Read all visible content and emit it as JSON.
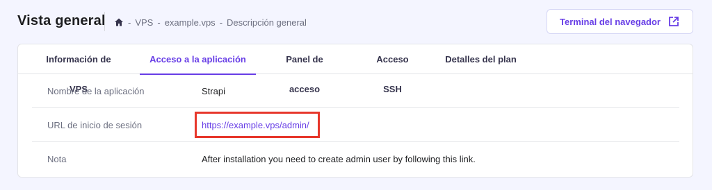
{
  "header": {
    "title": "Vista general",
    "breadcrumb": {
      "separator": "-",
      "items": [
        "VPS",
        "example.vps",
        "Descripción general"
      ]
    },
    "browser_terminal_label": "Terminal del navegador"
  },
  "tabs": [
    {
      "label": "Información de VPS",
      "active": false
    },
    {
      "label": "Acceso a la aplicación",
      "active": true
    },
    {
      "label": "Panel de acceso",
      "active": false
    },
    {
      "label": "Acceso SSH",
      "active": false
    },
    {
      "label": "Detalles del plan",
      "active": false
    }
  ],
  "details": [
    {
      "label": "Nombre de la aplicación",
      "value": "Strapi"
    },
    {
      "label": "URL de inicio de sesión",
      "value": "https://example.vps/admin/"
    },
    {
      "label": "Nota",
      "value": "After installation you need to create admin user by following this link."
    }
  ],
  "colors": {
    "accent": "#673de6",
    "highlight": "#e7372b",
    "background": "#f4f5ff"
  },
  "icons": {
    "home": "home-icon",
    "external": "external-link-icon"
  }
}
